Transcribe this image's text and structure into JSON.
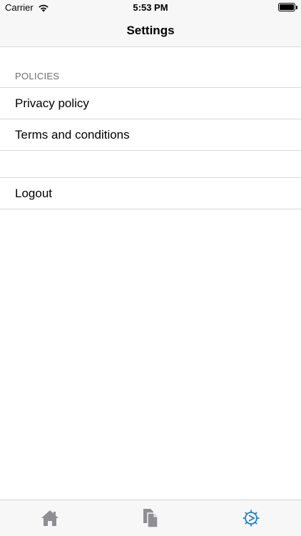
{
  "status_bar": {
    "carrier": "Carrier",
    "time": "5:53 PM",
    "wifi_icon": "wifi-icon",
    "battery_icon": "battery-icon"
  },
  "nav": {
    "title": "Settings"
  },
  "policies_section": {
    "header": "POLICIES",
    "items": [
      {
        "label": "Privacy policy"
      },
      {
        "label": "Terms and conditions"
      }
    ]
  },
  "account_section": {
    "items": [
      {
        "label": "Logout"
      }
    ]
  },
  "tab_bar": {
    "tabs": [
      {
        "icon": "home-icon",
        "selected": false
      },
      {
        "icon": "documents-icon",
        "selected": false
      },
      {
        "icon": "settings-gear-icon",
        "selected": true
      }
    ],
    "active_color": "#1a82d8",
    "inactive_color": "#8e8e93"
  }
}
